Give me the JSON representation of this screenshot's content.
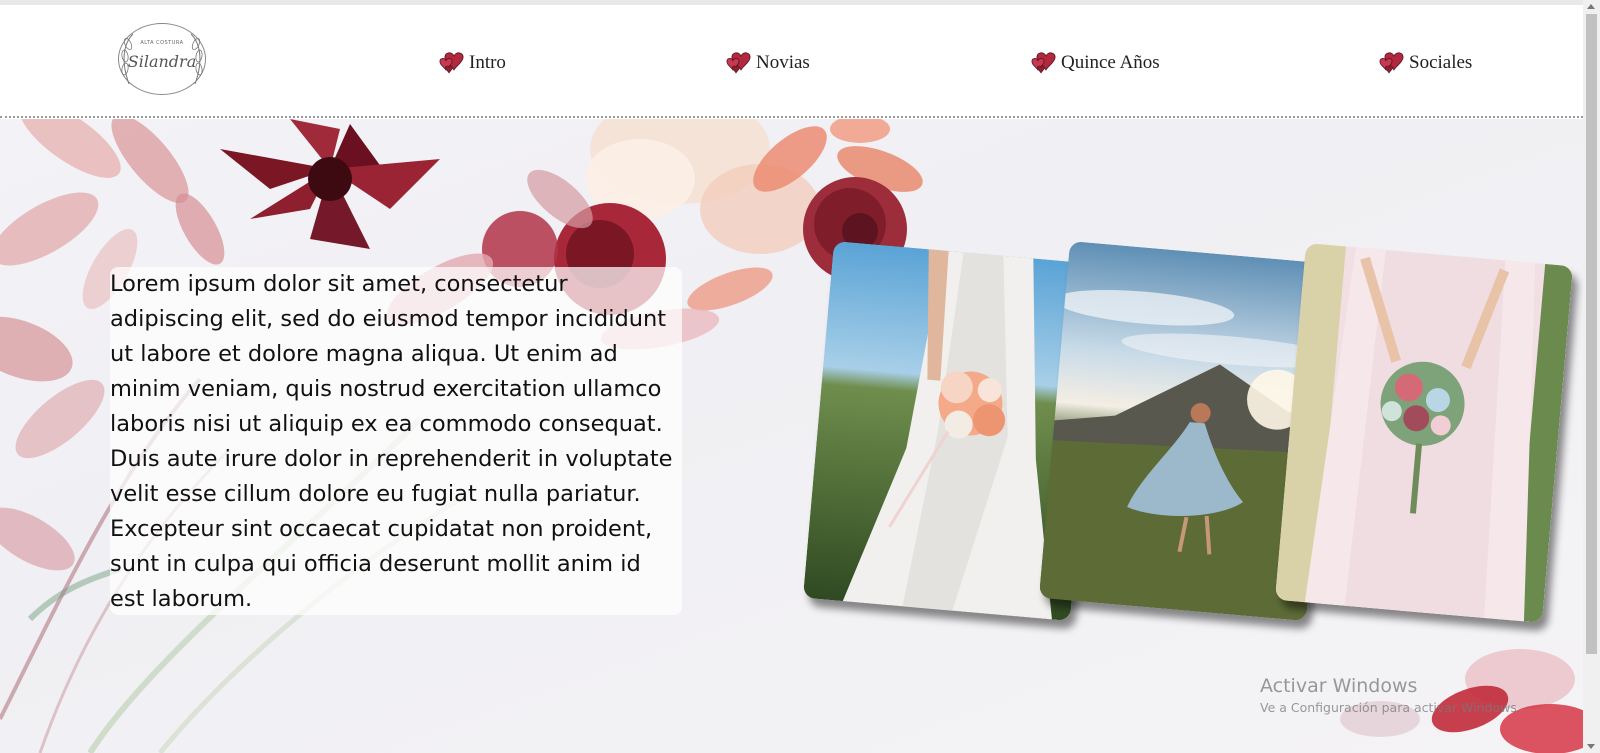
{
  "logo": {
    "subtitle": "ALTA COSTURA",
    "name": "Silandra",
    "icon": "floral-wreath-icon"
  },
  "nav": {
    "items": [
      {
        "label": "Intro",
        "icon": "hearts-icon"
      },
      {
        "label": "Novias",
        "icon": "hearts-icon"
      },
      {
        "label": "Quince Años",
        "icon": "hearts-icon"
      },
      {
        "label": "Sociales",
        "icon": "hearts-icon"
      }
    ]
  },
  "hero": {
    "paragraph": "Lorem ipsum dolor sit amet, consectetur adipiscing elit, sed do eiusmod tempor incididunt ut labore et dolore magna aliqua. Ut enim ad minim veniam, quis nostrud exercitation ullamco laboris nisi ut aliquip ex ea commodo consequat. Duis aute irure dolor in reprehenderit in voluptate velit esse cillum dolore eu fugiat nulla pariatur. Excepteur sint occaecat cupidatat non proident, sunt in culpa qui officia deserunt mollit anim id est laborum.",
    "photos": [
      "bride-bouquet-field-photo",
      "woman-dancing-mountains-photo",
      "bride-pink-dress-bouquet-photo"
    ]
  },
  "watermark": {
    "title": "Activar Windows",
    "subtitle": "Ve a Configuración para activar Windows."
  },
  "colors": {
    "heart": "#b2283f",
    "heart_dark": "#7a1a2c",
    "accent_flower": "#8e1f2e",
    "leaf": "#d98e8e"
  }
}
